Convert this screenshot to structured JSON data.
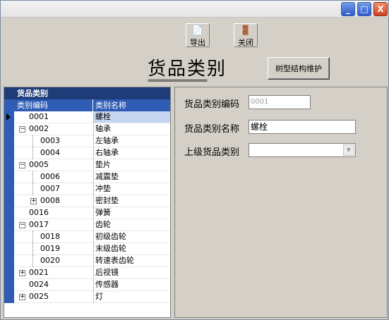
{
  "window": {
    "min": "_",
    "max": "□",
    "close": "X"
  },
  "toolbar": {
    "export_label": "导出",
    "export_icon": "export-doc-icon",
    "close_label": "关闭",
    "close_icon": "exit-door-icon"
  },
  "page": {
    "title": "货品类别",
    "underline": "===================",
    "maintain_button": "树型结构维护"
  },
  "tree": {
    "caption": "货品类别",
    "col_code": "类别编码",
    "col_name": "类别名称",
    "rows": [
      {
        "code": "0001",
        "name": "螺栓",
        "level": 0,
        "toggle": "",
        "selected": true
      },
      {
        "code": "0002",
        "name": "轴承",
        "level": 0,
        "toggle": "−"
      },
      {
        "code": "0003",
        "name": "左轴承",
        "level": 1,
        "toggle": ""
      },
      {
        "code": "0004",
        "name": "右轴承",
        "level": 1,
        "toggle": ""
      },
      {
        "code": "0005",
        "name": "垫片",
        "level": 0,
        "toggle": "−"
      },
      {
        "code": "0006",
        "name": "减震垫",
        "level": 1,
        "toggle": ""
      },
      {
        "code": "0007",
        "name": "冲垫",
        "level": 1,
        "toggle": ""
      },
      {
        "code": "0008",
        "name": "密封垫",
        "level": 1,
        "toggle": "+"
      },
      {
        "code": "0016",
        "name": "弹簧",
        "level": 0,
        "toggle": ""
      },
      {
        "code": "0017",
        "name": "齿轮",
        "level": 0,
        "toggle": "−"
      },
      {
        "code": "0018",
        "name": "初级齿轮",
        "level": 1,
        "toggle": ""
      },
      {
        "code": "0019",
        "name": "末级齿轮",
        "level": 1,
        "toggle": ""
      },
      {
        "code": "0020",
        "name": "转速表齿轮",
        "level": 1,
        "toggle": ""
      },
      {
        "code": "0021",
        "name": "后视镜",
        "level": 0,
        "toggle": "+"
      },
      {
        "code": "0024",
        "name": "传感器",
        "level": 0,
        "toggle": ""
      },
      {
        "code": "0025",
        "name": "灯",
        "level": 0,
        "toggle": "+"
      }
    ]
  },
  "form": {
    "code_label": "货品类别编码",
    "code_value": "0001",
    "name_label": "货品类别名称",
    "name_value": "螺栓",
    "parent_label": "上级货品类别",
    "parent_value": ""
  }
}
